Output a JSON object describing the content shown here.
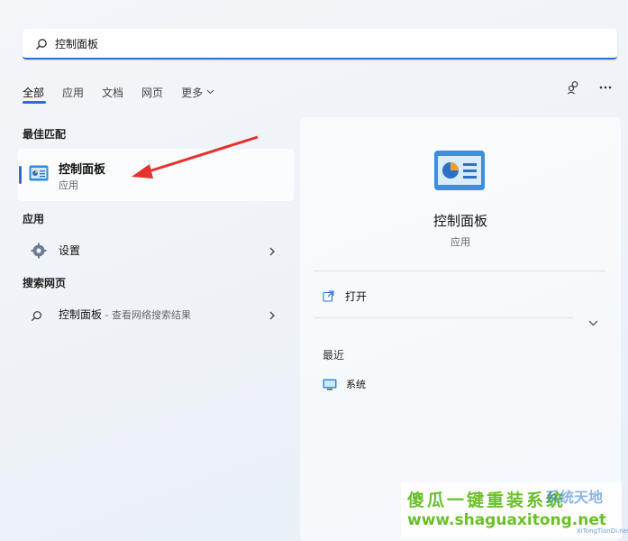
{
  "search": {
    "value": "控制面板"
  },
  "tabs": [
    {
      "label": "全部"
    },
    {
      "label": "应用"
    },
    {
      "label": "文档"
    },
    {
      "label": "网页"
    },
    {
      "label": "更多"
    }
  ],
  "left": {
    "best_match_title": "最佳匹配",
    "best_match": {
      "name": "控制面板",
      "type": "应用"
    },
    "apps_title": "应用",
    "apps": [
      {
        "label": "设置"
      }
    ],
    "web_title": "搜索网页",
    "web": [
      {
        "label": "控制面板",
        "sub": " - 查看网络搜索结果"
      }
    ]
  },
  "panel": {
    "title": "控制面板",
    "subtitle": "应用",
    "open_label": "打开",
    "recent_title": "最近",
    "recent": [
      {
        "label": "系统"
      }
    ]
  },
  "watermark": {
    "line1": "傻瓜一键重装系统",
    "line2": "www.shaguaxitong.net",
    "brand": "系统天地",
    "brand_url": "XiTongTianDi.net"
  },
  "colors": {
    "accent": "#2b6fd6",
    "arrow": "#e5322d",
    "watermark": "#6bbf2a"
  }
}
